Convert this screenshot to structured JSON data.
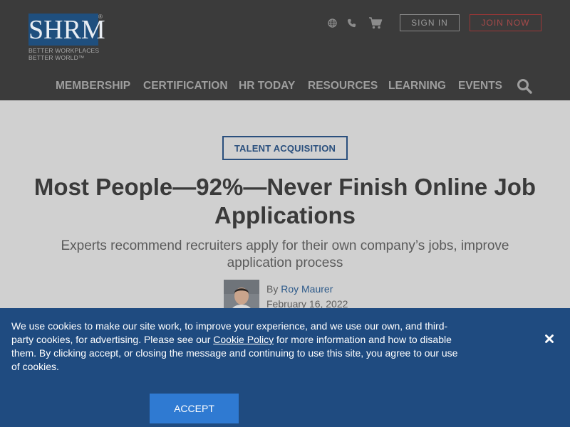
{
  "header": {
    "logo": {
      "wordmark": "SHRM",
      "registered": "®",
      "tagline_line1": "BETTER WORKPLACES",
      "tagline_line2": "BETTER WORLD™"
    },
    "utility_icons": [
      "globe-icon",
      "phone-icon",
      "cart-icon"
    ],
    "sign_in_label": "SIGN IN",
    "join_now_label": "JOIN NOW",
    "nav": [
      {
        "label": "MEMBERSHIP"
      },
      {
        "label": "CERTIFICATION"
      },
      {
        "label": "HR TODAY"
      },
      {
        "label": "RESOURCES"
      },
      {
        "label": "LEARNING"
      },
      {
        "label": "EVENTS"
      }
    ],
    "search_icon": "search-icon"
  },
  "article": {
    "category": "TALENT ACQUISITION",
    "title": "Most People—92%—Never Finish Online Job Applications",
    "subtitle": "Experts recommend recruiters apply for their own company’s jobs, improve application process",
    "byline_prefix": "By",
    "author": "Roy Maurer",
    "date": "February 16, 2022"
  },
  "cookie_banner": {
    "text_before_link": "We use cookies to make our site work, to improve your experience, and we use our own, and third-party cookies, for advertising. Please see our ",
    "link_text": "Cookie Policy",
    "text_after_link": " for more information and how to disable them. By clicking accept, or closing the message and continuing to use this site, you agree to our use of cookies.",
    "close_icon": "close-icon",
    "accept_label": "ACCEPT"
  },
  "colors": {
    "header_bg": "#3b3b3b",
    "page_bg": "#d0d0d0",
    "brand_blue": "#1f4f7e",
    "join_red": "#9c3636",
    "banner_bg": "#1f4b80",
    "accept_bg": "#2f7ad2"
  }
}
